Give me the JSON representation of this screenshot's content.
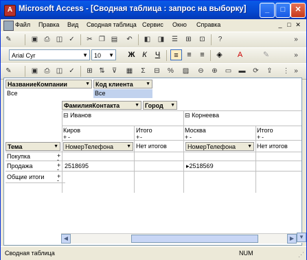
{
  "window": {
    "title": "Microsoft Access - [Сводная таблица : запрос на выборку]",
    "controls": {
      "minimize": "_",
      "maximize": "□",
      "close": "✕"
    }
  },
  "menu": {
    "items": [
      "Файл",
      "Правка",
      "Вид",
      "Сводная таблица",
      "Сервис",
      "Окно",
      "Справка"
    ],
    "mdi_controls": {
      "minimize": "_",
      "restore": "□",
      "close": "✕"
    }
  },
  "toolbars": {
    "font": {
      "name": "Arial Cyr",
      "size": "10"
    },
    "format_buttons": {
      "bold": "Ж",
      "italic": "К",
      "underline": "Ч"
    }
  },
  "pivot": {
    "filter_fields": [
      {
        "label": "НазваниеКомпании",
        "value": "Все"
      },
      {
        "label": "Код клиента",
        "value": "Все"
      }
    ],
    "column_fields": [
      "ФамилияКонтакта",
      "Город"
    ],
    "column_groups": [
      {
        "label": "Иванов",
        "expander": "⊟",
        "cities": [
          "Киров"
        ],
        "total": "Итого"
      },
      {
        "label": "Корнеева",
        "expander": "⊟",
        "cities": [
          "Москва"
        ],
        "total": "Итого"
      }
    ],
    "row_field": "Тема",
    "data_field": "НомерТелефона",
    "no_totals": "Нет итогов",
    "rows": [
      {
        "label": "Покупка",
        "values": [
          "",
          ""
        ]
      },
      {
        "label": "Продажа",
        "values": [
          "2518695",
          "2518569"
        ]
      },
      {
        "label": "Общие итоги",
        "values": [
          "",
          ""
        ]
      }
    ],
    "expand_marks": [
      "+",
      "-"
    ]
  },
  "status": {
    "left": "Сводная таблица",
    "right": "NUM"
  }
}
